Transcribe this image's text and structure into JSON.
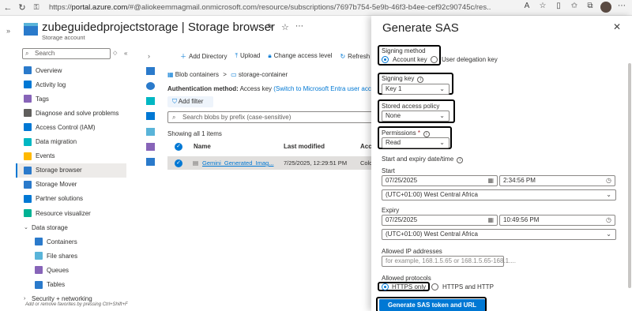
{
  "browser": {
    "url_prefix": "https://",
    "url_host": "portal.azure.com",
    "url_rest": "/#@aliokeemmagmail.onmicrosoft.com/resource/subscriptions/7697b754-5e9b-46f3-b4ee-cef92c90745c/res..."
  },
  "resource": {
    "title": "zubeguidedprojectstorage | Storage browser",
    "subtitle": "Storage account"
  },
  "sidebar": {
    "search_placeholder": "Search",
    "items": [
      {
        "label": "Overview",
        "icon": "overview-icon",
        "color": "#2a7acb"
      },
      {
        "label": "Activity log",
        "icon": "activity-log-icon",
        "color": "#0078d4"
      },
      {
        "label": "Tags",
        "icon": "tag-icon",
        "color": "#8764b8"
      },
      {
        "label": "Diagnose and solve problems",
        "icon": "diagnose-icon",
        "color": "#605e5c"
      },
      {
        "label": "Access Control (IAM)",
        "icon": "iam-icon",
        "color": "#0078d4"
      },
      {
        "label": "Data migration",
        "icon": "data-migration-icon",
        "color": "#00b7c3"
      },
      {
        "label": "Events",
        "icon": "events-icon",
        "color": "#ffb900"
      },
      {
        "label": "Storage browser",
        "icon": "storage-browser-icon",
        "color": "#2a7acb"
      },
      {
        "label": "Storage Mover",
        "icon": "storage-mover-icon",
        "color": "#2a7acb"
      },
      {
        "label": "Partner solutions",
        "icon": "partner-icon",
        "color": "#0078d4"
      },
      {
        "label": "Resource visualizer",
        "icon": "visualizer-icon",
        "color": "#00b294"
      },
      {
        "label": "Data storage",
        "icon": "",
        "color": ""
      },
      {
        "label": "Containers",
        "icon": "containers-icon",
        "color": "#2a7acb"
      },
      {
        "label": "File shares",
        "icon": "file-shares-icon",
        "color": "#59b4d9"
      },
      {
        "label": "Queues",
        "icon": "queues-icon",
        "color": "#8764b8"
      },
      {
        "label": "Tables",
        "icon": "tables-icon",
        "color": "#2a7acb"
      },
      {
        "label": "Security + networking",
        "icon": "",
        "color": ""
      }
    ],
    "favorites_hint": "Add or remove favorites by pressing Ctrl+Shift+F"
  },
  "toolbar": {
    "add_directory": "Add Directory",
    "upload": "Upload",
    "change_access": "Change access level",
    "refresh": "Refresh"
  },
  "breadcrumb": {
    "root": "Blob containers",
    "sep": ">",
    "current": "storage-container"
  },
  "auth": {
    "label": "Authentication method:",
    "value": "Access key",
    "link": "(Switch to Microsoft Entra user account)"
  },
  "filter": {
    "add_filter": "Add filter",
    "search_placeholder": "Search blobs by prefix (case-sensitive)"
  },
  "listing": {
    "showing": "Showing all 1 items",
    "headers": [
      "Name",
      "Last modified",
      "Acce"
    ],
    "rows": [
      {
        "name": "Gemini_Generated_Imag...",
        "modified": "7/25/2025, 12:29:51 PM",
        "access": "Cold"
      }
    ]
  },
  "sas": {
    "title": "Generate SAS",
    "signing_method_label": "Signing method",
    "signing_method_options": [
      "Account key",
      "User delegation key"
    ],
    "signing_key_label": "Signing key",
    "signing_key_value": "Key 1",
    "stored_policy_label": "Stored access policy",
    "stored_policy_value": "None",
    "permissions_label": "Permissions",
    "permissions_required": "*",
    "permissions_value": "Read",
    "start_expiry_label": "Start and expiry date/time",
    "start_label": "Start",
    "start_date": "07/25/2025",
    "start_time": "2:34:56 PM",
    "start_tz": "(UTC+01:00) West Central Africa",
    "expiry_label": "Expiry",
    "expiry_date": "07/25/2025",
    "expiry_time": "10:49:56 PM",
    "expiry_tz": "(UTC+01:00) West Central Africa",
    "ip_label": "Allowed IP addresses",
    "ip_placeholder": "for example, 168.1.5.65 or 168.1.5.65-168.1....",
    "protocols_label": "Allowed protocols",
    "protocol_options": [
      "HTTPS only",
      "HTTPS and HTTP"
    ],
    "generate_button": "Generate SAS token and URL"
  }
}
